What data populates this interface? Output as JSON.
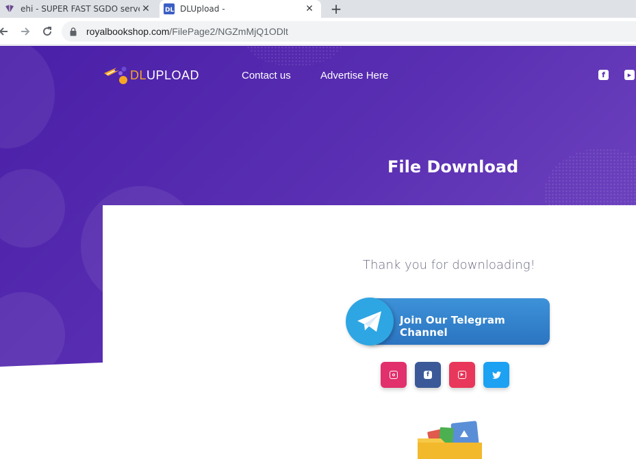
{
  "browser": {
    "tabs": [
      {
        "title": "ehi - SUPER FAST SGDO server= s",
        "active": false
      },
      {
        "title": "DLUpload -",
        "active": true
      }
    ],
    "new_tab_symbol": "+",
    "close_symbol": "✕",
    "url": {
      "domain": "royalbookshop.com",
      "path": "/FilePage2/NGZmMjQ1ODlt"
    }
  },
  "site": {
    "logo": {
      "brand_prefix": "DL",
      "brand_suffix": "UPLOAD"
    },
    "nav": [
      {
        "label": "Contact us"
      },
      {
        "label": "Advertise Here"
      }
    ],
    "top_social": [
      {
        "icon": "facebook-icon",
        "glyph": "f"
      },
      {
        "icon": "youtube-icon",
        "glyph": "▶"
      }
    ],
    "hero_title": "File Download",
    "thanks_message": "Thank you for downloading!",
    "telegram_button": {
      "label": "Join Our Telegram Channel"
    },
    "social_buttons": [
      {
        "name": "instagram-button",
        "icon": "instagram-icon",
        "color": "#e1306c",
        "glyph": "◎"
      },
      {
        "name": "facebook-button",
        "icon": "facebook-icon",
        "color": "#3b5998",
        "glyph": "f"
      },
      {
        "name": "youtube-button",
        "icon": "youtube-icon",
        "color": "#e8375a",
        "glyph": "▶"
      },
      {
        "name": "twitter-button",
        "icon": "twitter-icon",
        "color": "#1da1f2",
        "glyph": "🐦"
      }
    ]
  },
  "colors": {
    "hero_gradient_start": "#4a1fa8",
    "hero_gradient_end": "#7a4fc7",
    "logo_accent": "#f5a623",
    "telegram": "#2ea6e3"
  }
}
